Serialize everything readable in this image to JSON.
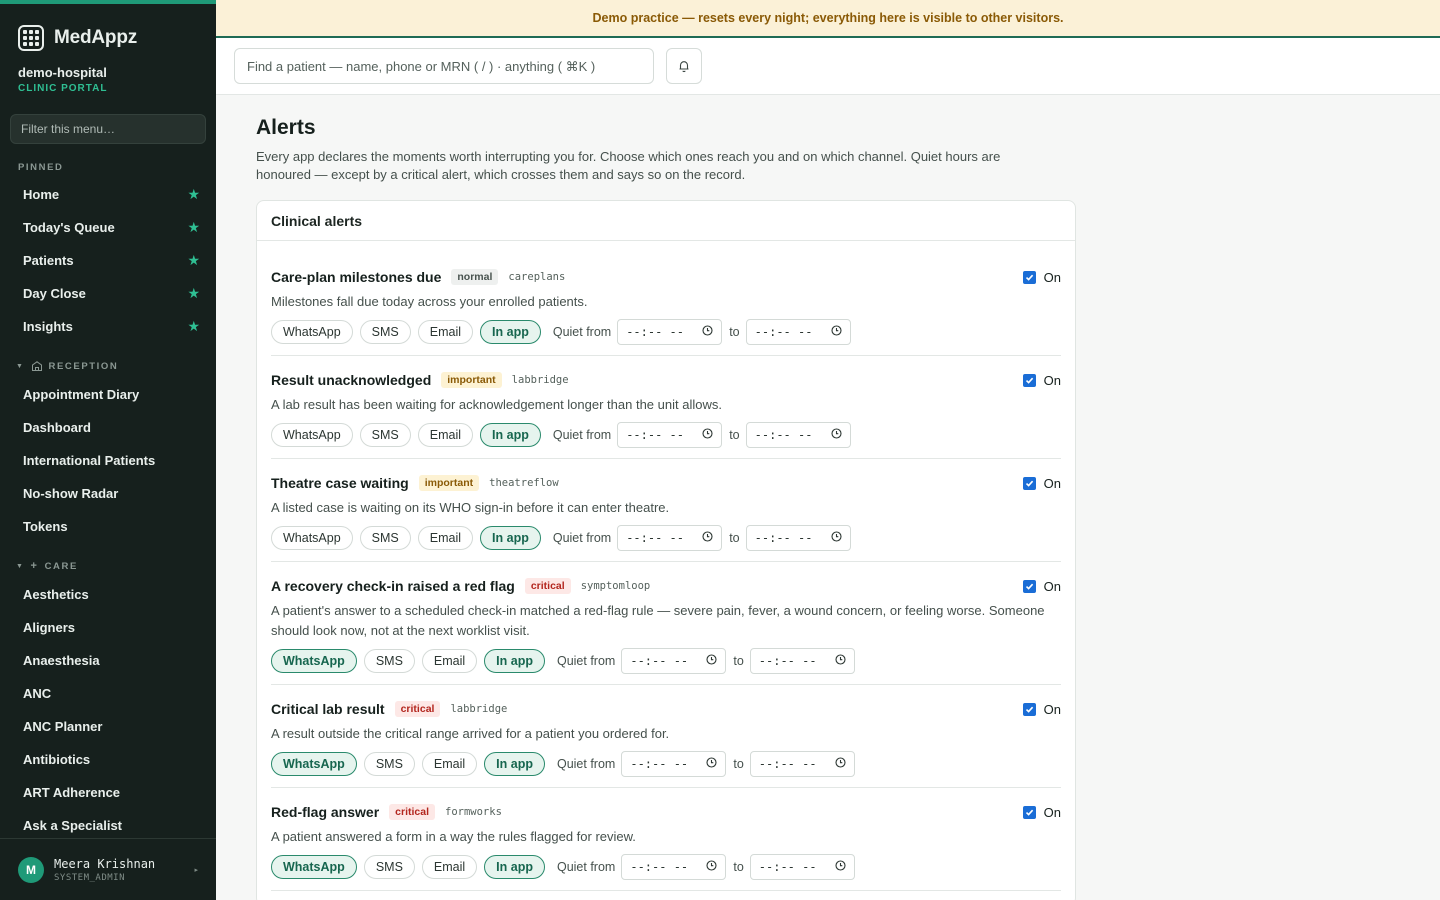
{
  "brand": {
    "name": "MedAppz"
  },
  "org": {
    "name": "demo-hospital",
    "subtitle": "CLINIC PORTAL"
  },
  "sidebar": {
    "filter_placeholder": "Filter this menu…",
    "pinned": {
      "label": "PINNED",
      "items": [
        {
          "label": "Home"
        },
        {
          "label": "Today's Queue"
        },
        {
          "label": "Patients"
        },
        {
          "label": "Day Close"
        },
        {
          "label": "Insights"
        }
      ]
    },
    "reception": {
      "label": "RECEPTION",
      "items": [
        {
          "label": "Appointment Diary"
        },
        {
          "label": "Dashboard"
        },
        {
          "label": "International Patients"
        },
        {
          "label": "No-show Radar"
        },
        {
          "label": "Tokens"
        }
      ]
    },
    "care": {
      "label": "CARE",
      "items": [
        {
          "label": "Aesthetics"
        },
        {
          "label": "Aligners"
        },
        {
          "label": "Anaesthesia"
        },
        {
          "label": "ANC"
        },
        {
          "label": "ANC Planner"
        },
        {
          "label": "Antibiotics"
        },
        {
          "label": "ART Adherence"
        },
        {
          "label": "Ask a Specialist"
        }
      ]
    }
  },
  "user": {
    "initial": "M",
    "name": "Meera Krishnan",
    "role": "SYSTEM_ADMIN"
  },
  "banner": {
    "text": "Demo practice — resets every night; everything here is visible to other visitors."
  },
  "topbar": {
    "search_placeholder": "Find a patient — name, phone or MRN ( / ) · anything ( ⌘K )"
  },
  "page": {
    "title": "Alerts",
    "description": "Every app declares the moments worth interrupting you for. Choose which ones reach you and on which channel. Quiet hours are honoured — except by a critical alert, which crosses them and says so on the record."
  },
  "card": {
    "title": "Clinical alerts",
    "toggle_label": "On",
    "channels": [
      "WhatsApp",
      "SMS",
      "Email",
      "In app"
    ],
    "quiet_from_label": "Quiet from",
    "to_label": "to",
    "time_placeholder": "--:-- --",
    "alerts": [
      {
        "title": "Care-plan milestones due",
        "severity": "normal",
        "source": "careplans",
        "description": "Milestones fall due today across your enrolled patients.",
        "enabled": true,
        "active_channels": [
          "In app"
        ]
      },
      {
        "title": "Result unacknowledged",
        "severity": "important",
        "source": "labbridge",
        "description": "A lab result has been waiting for acknowledgement longer than the unit allows.",
        "enabled": true,
        "active_channels": [
          "In app"
        ]
      },
      {
        "title": "Theatre case waiting",
        "severity": "important",
        "source": "theatreflow",
        "description": "A listed case is waiting on its WHO sign-in before it can enter theatre.",
        "enabled": true,
        "active_channels": [
          "In app"
        ]
      },
      {
        "title": "A recovery check-in raised a red flag",
        "severity": "critical",
        "source": "symptomloop",
        "description": "A patient's answer to a scheduled check-in matched a red-flag rule — severe pain, fever, a wound concern, or feeling worse. Someone should look now, not at the next worklist visit.",
        "enabled": true,
        "active_channels": [
          "WhatsApp",
          "In app"
        ]
      },
      {
        "title": "Critical lab result",
        "severity": "critical",
        "source": "labbridge",
        "description": "A result outside the critical range arrived for a patient you ordered for.",
        "enabled": true,
        "active_channels": [
          "WhatsApp",
          "In app"
        ]
      },
      {
        "title": "Red-flag answer",
        "severity": "critical",
        "source": "formworks",
        "description": "A patient answered a form in a way the rules flagged for review.",
        "enabled": true,
        "active_channels": [
          "WhatsApp",
          "In app"
        ]
      }
    ]
  }
}
